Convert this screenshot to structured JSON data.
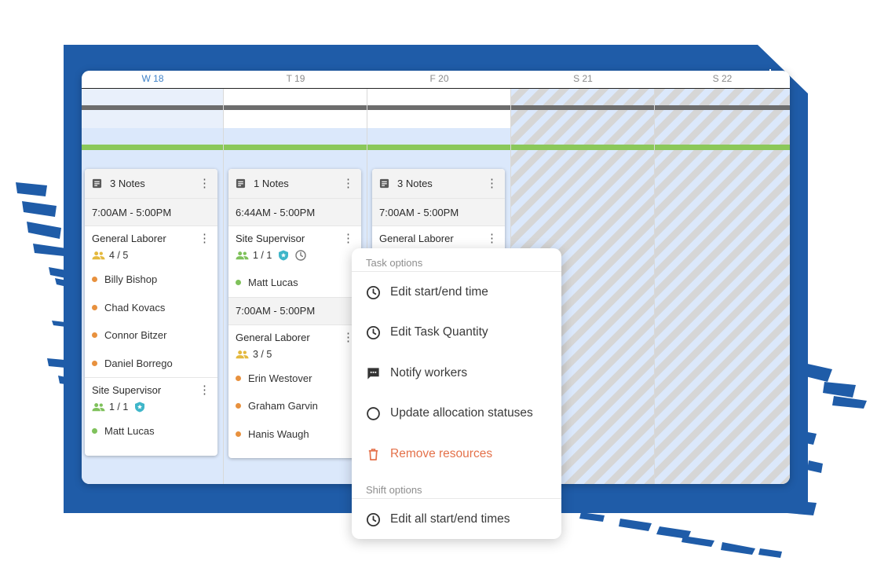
{
  "colors": {
    "brand_blue": "#1f5ca8",
    "accent_green": "#8bc85a",
    "danger": "#e4714a",
    "dot_orange": "#e8913e",
    "dot_green": "#7fc15b",
    "badge_teal": "#3fb6c9",
    "people_gold": "#e4b93e",
    "people_green": "#7fc15b"
  },
  "days": [
    {
      "label": "W 18",
      "highlight": true
    },
    {
      "label": "T 19"
    },
    {
      "label": "F 20"
    },
    {
      "label": "S 21",
      "weekend": true
    },
    {
      "label": "S 22",
      "weekend": true
    }
  ],
  "cards": [
    {
      "notes": "3 Notes",
      "shifts": [
        {
          "time": "7:00AM - 5:00PM",
          "roles": [
            {
              "title": "General Laborer",
              "qty": "4 / 5",
              "people_icon": "people-icon",
              "workers": [
                {
                  "name": "Billy Bishop",
                  "status": "orange"
                },
                {
                  "name": "Chad Kovacs",
                  "status": "orange"
                },
                {
                  "name": "Connor Bitzer",
                  "status": "orange"
                },
                {
                  "name": "Daniel Borrego",
                  "status": "orange"
                }
              ]
            },
            {
              "title": "Site Supervisor",
              "qty": "1 / 1",
              "people_icon": "people-icon",
              "badge": true,
              "workers": [
                {
                  "name": "Matt Lucas",
                  "status": "green"
                }
              ]
            }
          ]
        }
      ]
    },
    {
      "notes": "1 Notes",
      "shifts": [
        {
          "time": "6:44AM - 5:00PM",
          "roles": [
            {
              "title": "Site Supervisor",
              "qty": "1 / 1",
              "people_icon": "people-icon",
              "badge": true,
              "clock": true,
              "workers": [
                {
                  "name": "Matt Lucas",
                  "status": "green"
                }
              ]
            }
          ]
        },
        {
          "time": "7:00AM - 5:00PM",
          "roles": [
            {
              "title": "General Laborer",
              "qty": "3 / 5",
              "people_icon": "people-icon",
              "workers": [
                {
                  "name": "Erin Westover",
                  "status": "orange"
                },
                {
                  "name": "Graham Garvin",
                  "status": "orange"
                },
                {
                  "name": "Hanis Waugh",
                  "status": "orange"
                }
              ]
            }
          ]
        }
      ]
    },
    {
      "notes": "3 Notes",
      "shifts": [
        {
          "time": "7:00AM - 5:00PM",
          "roles": [
            {
              "title": "General Laborer"
            }
          ]
        }
      ]
    }
  ],
  "menu": {
    "task_section": "Task options",
    "task_items": [
      {
        "label": "Edit start/end time",
        "icon": "clock-icon"
      },
      {
        "label": "Edit Task Quantity",
        "icon": "clock-icon"
      },
      {
        "label": "Notify workers",
        "icon": "message-icon"
      },
      {
        "label": "Update allocation statuses",
        "icon": "circle-icon"
      },
      {
        "label": "Remove resources",
        "icon": "trash-icon",
        "danger": true
      }
    ],
    "shift_section": "Shift options",
    "shift_items": [
      {
        "label": "Edit all start/end times",
        "icon": "clock-icon"
      }
    ]
  }
}
